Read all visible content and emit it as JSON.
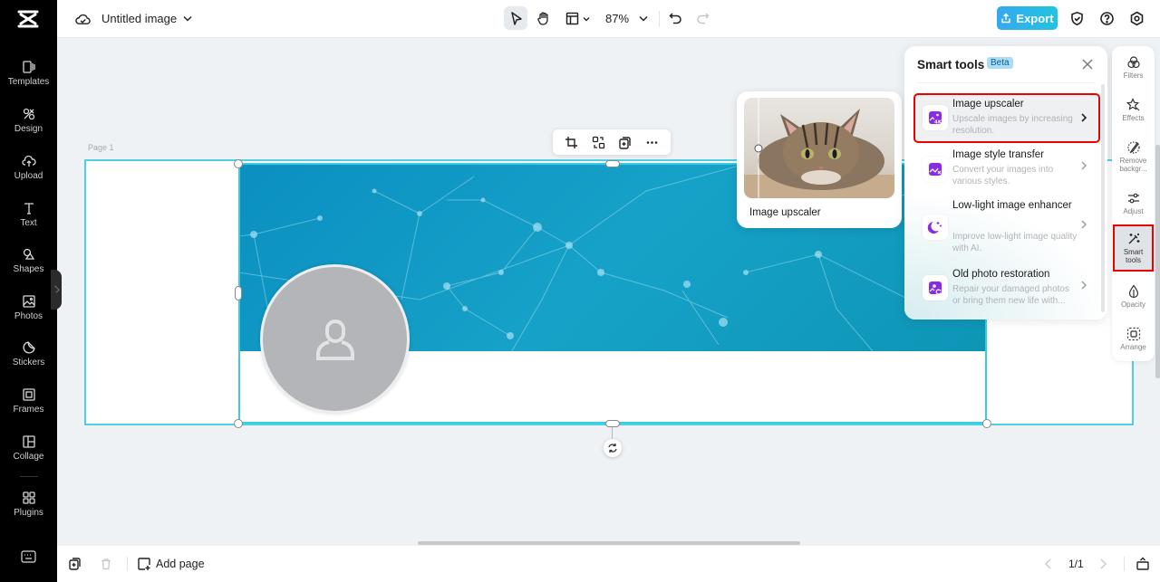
{
  "app": {
    "document_title": "Untitled image",
    "zoom_level": "87%",
    "export_label": "Export"
  },
  "sidebar": {
    "items": [
      {
        "label": "Templates",
        "icon": "templates-icon"
      },
      {
        "label": "Design",
        "icon": "design-icon"
      },
      {
        "label": "Upload",
        "icon": "upload-icon"
      },
      {
        "label": "Text",
        "icon": "text-icon"
      },
      {
        "label": "Shapes",
        "icon": "shapes-icon"
      },
      {
        "label": "Photos",
        "icon": "photos-icon"
      },
      {
        "label": "Stickers",
        "icon": "stickers-icon"
      },
      {
        "label": "Frames",
        "icon": "frames-icon"
      },
      {
        "label": "Collage",
        "icon": "collage-icon"
      },
      {
        "label": "Plugins",
        "icon": "plugins-icon"
      }
    ]
  },
  "canvas": {
    "page_label": "Page 1"
  },
  "preview_card": {
    "title": "Image upscaler"
  },
  "smart_tools": {
    "title": "Smart tools",
    "badge": "Beta",
    "items": [
      {
        "name": "Image upscaler",
        "description": "Upscale images by increasing resolution.",
        "icon": "upscale-4k-icon",
        "active": true
      },
      {
        "name": "Image style transfer",
        "description": "Convert your images into various styles.",
        "icon": "style-transfer-icon",
        "active": false
      },
      {
        "name": "Low-light image enhancer",
        "description": "Improve low-light image quality with AI.",
        "icon": "moon-sparkle-icon",
        "active": false
      },
      {
        "name": "Old photo restoration",
        "description": "Repair your damaged photos or bring them new life with...",
        "icon": "photo-restore-icon",
        "active": false
      }
    ]
  },
  "right_toolbar": {
    "items": [
      {
        "label": "Filters"
      },
      {
        "label": "Effects"
      },
      {
        "label": "Remove backgr..."
      },
      {
        "label": "Adjust"
      },
      {
        "label": "Smart tools",
        "active": true
      },
      {
        "label": "Opacity"
      },
      {
        "label": "Arrange"
      }
    ]
  },
  "bottom_bar": {
    "add_page_label": "Add page",
    "page_indicator": "1/1"
  },
  "colors": {
    "accent": "#22c4e0",
    "selection": "#3ccbe0",
    "highlight_outline": "#ee0000",
    "tool_icon": "#8a2be2"
  }
}
